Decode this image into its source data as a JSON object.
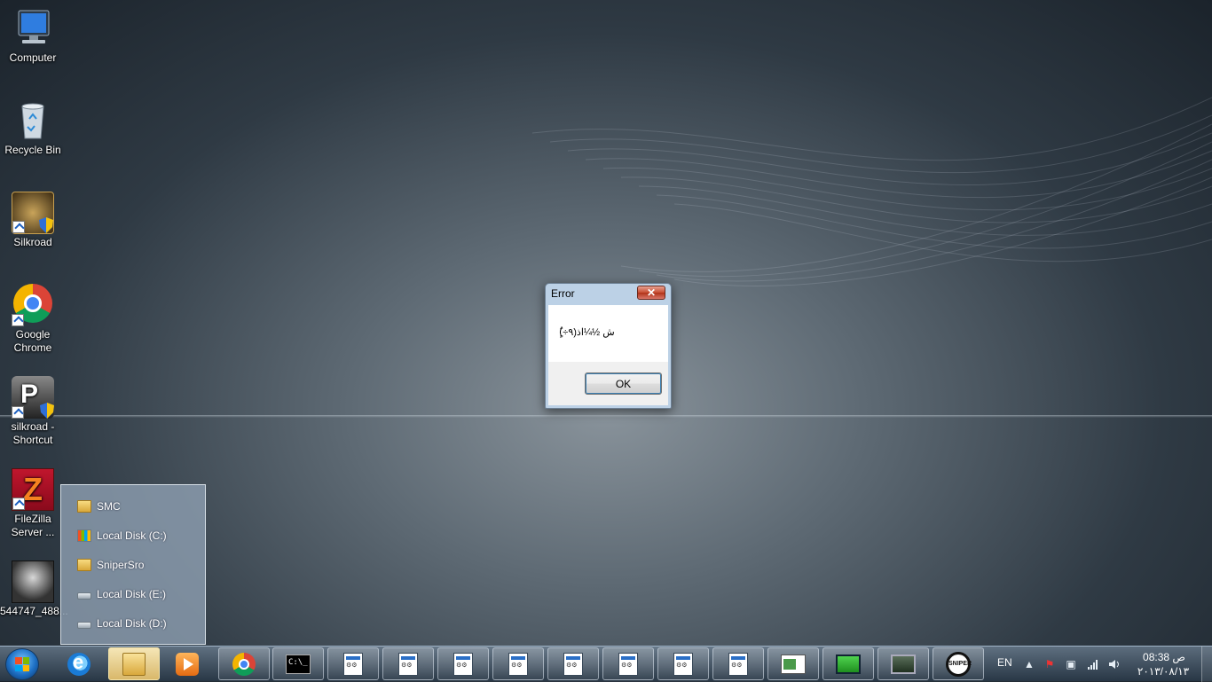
{
  "desktop": {
    "icons": [
      {
        "label": "Computer",
        "icon": "computer-icon"
      },
      {
        "label": "Recycle Bin",
        "icon": "recycle-bin-icon"
      },
      {
        "label": "Silkroad",
        "icon": "silkroad-icon"
      },
      {
        "label": "Google Chrome",
        "icon": "chrome-icon"
      },
      {
        "label": "silkroad - Shortcut",
        "icon": "silkroad-shortcut-icon"
      },
      {
        "label": "FileZilla Server ...",
        "icon": "filezilla-icon"
      },
      {
        "label": "544747_488...",
        "icon": "image-file-icon"
      }
    ]
  },
  "dialog": {
    "title": "Error",
    "close_label": "✕",
    "message": "(ٌٍ÷ش ½¼اذ(٩",
    "ok_label": "OK"
  },
  "popup": {
    "items": [
      {
        "label": "SMC",
        "icon": "folder-icon"
      },
      {
        "label": "Local Disk (C:)",
        "icon": "windows-drive-icon"
      },
      {
        "label": "SniperSro",
        "icon": "folder-icon"
      },
      {
        "label": "Local Disk (E:)",
        "icon": "drive-icon"
      },
      {
        "label": "Local Disk (D:)",
        "icon": "drive-icon"
      }
    ]
  },
  "taskbar": {
    "cmd_text": "C:\\_",
    "sniper_text": "SNIPER",
    "language": "EN",
    "time": "08:38 ص",
    "date": "٢٠١٣/٠٨/١٣"
  }
}
